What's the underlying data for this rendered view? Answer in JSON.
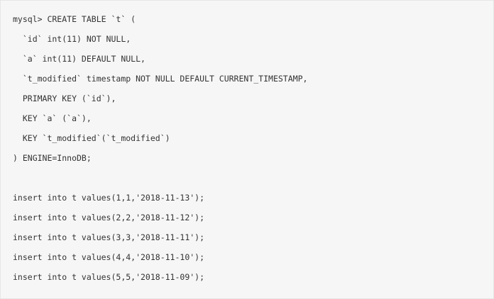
{
  "code": {
    "lines": [
      "mysql> CREATE TABLE `t` (",
      "  `id` int(11) NOT NULL,",
      "  `a` int(11) DEFAULT NULL,",
      "  `t_modified` timestamp NOT NULL DEFAULT CURRENT_TIMESTAMP,",
      "  PRIMARY KEY (`id`),",
      "  KEY `a` (`a`),",
      "  KEY `t_modified`(`t_modified`)",
      ") ENGINE=InnoDB;",
      "",
      "insert into t values(1,1,'2018-11-13');",
      "insert into t values(2,2,'2018-11-12');",
      "insert into t values(3,3,'2018-11-11');",
      "insert into t values(4,4,'2018-11-10');",
      "insert into t values(5,5,'2018-11-09');"
    ]
  }
}
